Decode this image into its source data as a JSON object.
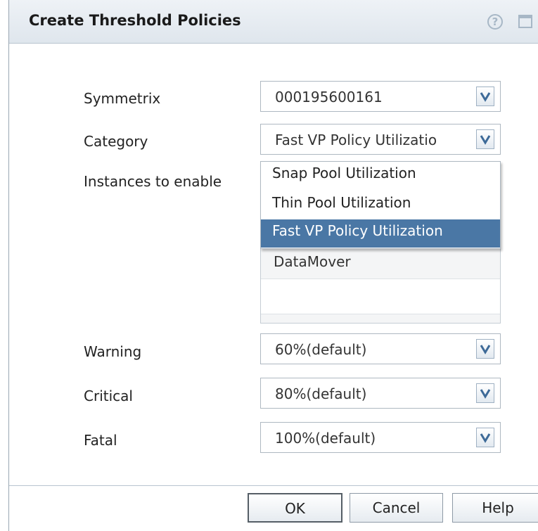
{
  "dialog": {
    "title": "Create Threshold Policies",
    "help_icon": "question-circle-icon",
    "maximize_icon": "maximize-window-icon"
  },
  "form": {
    "symmetrix": {
      "label": "Symmetrix",
      "value": "000195600161"
    },
    "category": {
      "label": "Category",
      "value": "Fast VP Policy Utilizatio",
      "options": [
        "Snap Pool Utilization",
        "Thin Pool Utilization",
        "Fast VP Policy Utilization"
      ],
      "selected_option": "Fast VP Policy Utilization"
    },
    "instances": {
      "label": "Instances to enable",
      "items": [
        "DataMover",
        ""
      ]
    },
    "warning": {
      "label": "Warning",
      "value": "60%(default)"
    },
    "critical": {
      "label": "Critical",
      "value": "80%(default)"
    },
    "fatal": {
      "label": "Fatal",
      "value": "100%(default)"
    }
  },
  "buttons": {
    "ok": "OK",
    "cancel": "Cancel",
    "help": "Help"
  },
  "colors": {
    "selected_highlight": "#4a77a5",
    "titlebar": "#e4eaf0"
  }
}
